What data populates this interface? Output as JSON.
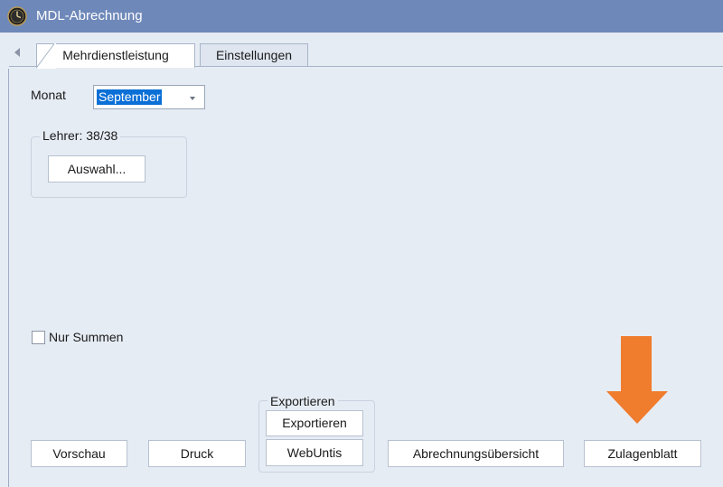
{
  "window": {
    "title": "MDL-Abrechnung",
    "icon": "clock-icon"
  },
  "tabs": [
    {
      "label": "Mehrdienstleistung",
      "active": true
    },
    {
      "label": "Einstellungen",
      "active": false
    }
  ],
  "month": {
    "label": "Monat",
    "selected": "September"
  },
  "teacher_group": {
    "legend": "Lehrer: 38/38",
    "select_button": "Auswahl..."
  },
  "options": {
    "sums_only_label": "Nur Summen",
    "sums_only_checked": false
  },
  "export_group": {
    "legend": "Exportieren",
    "export_button": "Exportieren",
    "webuntis_button": "WebUntis"
  },
  "actions": {
    "preview": "Vorschau",
    "print": "Druck",
    "billing_overview": "Abrechnungsübersicht",
    "allowance_sheet": "Zulagenblatt"
  },
  "annotation": {
    "icon": "arrow-down-icon",
    "color": "#f07c2e"
  }
}
